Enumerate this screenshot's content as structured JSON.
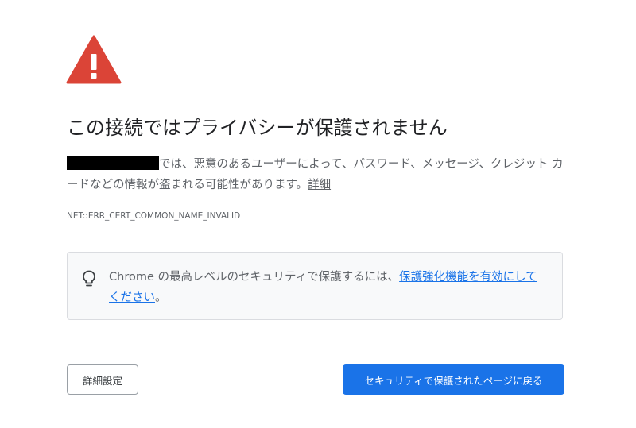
{
  "colors": {
    "warning_red": "#db4437",
    "primary_blue": "#1a73e8",
    "heading_text": "#202124",
    "body_text": "#5f6368",
    "box_background": "#f8f9fa",
    "box_border": "#dadce0",
    "redaction": "#000000"
  },
  "icons": {
    "warning": "warning-triangle-icon",
    "tip": "lightbulb-icon"
  },
  "interstitial": {
    "heading": "この接続ではプライバシーが保護されません",
    "body": "では、悪意のあるユーザーによって、パスワード、メッセージ、クレジット カードなどの情報が盗まれる可能性があります。",
    "details_link": "詳細",
    "error_code": "NET::ERR_CERT_COMMON_NAME_INVALID"
  },
  "enhanced_protection": {
    "text": "Chrome の最高レベルのセキュリティで保護するには、",
    "link": "保護強化機能を有効にしてください",
    "suffix": "。"
  },
  "buttons": {
    "advanced": "詳細設定",
    "back_to_safety": "セキュリティで保護されたページに戻る"
  }
}
